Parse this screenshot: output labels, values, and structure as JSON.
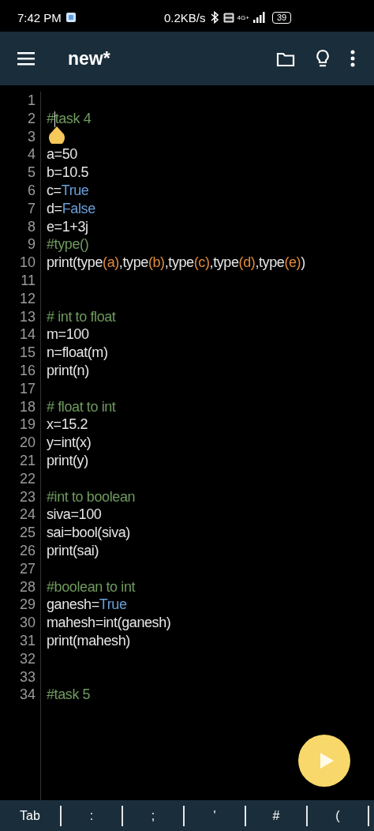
{
  "status_bar": {
    "time": "7:42 PM",
    "speed": "0.2KB/s",
    "network": "4G+",
    "battery": "39"
  },
  "app_bar": {
    "title": "new*"
  },
  "editor": {
    "lines": [
      {
        "number": "1"
      },
      {
        "number": "2",
        "cursor": true,
        "tokens": [
          {
            "kind": "comment",
            "text": "#task 4"
          }
        ]
      },
      {
        "number": "3"
      },
      {
        "number": "4",
        "tokens": [
          {
            "kind": "plain",
            "text": "a=50"
          }
        ]
      },
      {
        "number": "5",
        "tokens": [
          {
            "kind": "plain",
            "text": "b=10.5"
          }
        ]
      },
      {
        "number": "6",
        "tokens": [
          {
            "kind": "plain",
            "text": "c="
          },
          {
            "kind": "keyword",
            "text": "True"
          }
        ]
      },
      {
        "number": "7",
        "tokens": [
          {
            "kind": "plain",
            "text": "d="
          },
          {
            "kind": "keyword",
            "text": "False"
          }
        ]
      },
      {
        "number": "8",
        "tokens": [
          {
            "kind": "plain",
            "text": "e=1+3j"
          }
        ]
      },
      {
        "number": "9",
        "tokens": [
          {
            "kind": "comment",
            "text": "#type()"
          }
        ]
      },
      {
        "number": "10",
        "tokens": [
          {
            "kind": "plain",
            "text": "print(type"
          },
          {
            "kind": "bracket",
            "text": "(a)"
          },
          {
            "kind": "plain",
            "text": ",type"
          },
          {
            "kind": "bracket",
            "text": "(b)"
          },
          {
            "kind": "plain",
            "text": ",type"
          },
          {
            "kind": "bracket",
            "text": "(c)"
          },
          {
            "kind": "plain",
            "text": ",type"
          },
          {
            "kind": "bracket",
            "text": "(d)"
          },
          {
            "kind": "plain",
            "text": ",type"
          },
          {
            "kind": "bracket",
            "text": "(e)"
          },
          {
            "kind": "plain",
            "text": ")"
          }
        ]
      },
      {
        "number": "11"
      },
      {
        "number": "12"
      },
      {
        "number": "13",
        "tokens": [
          {
            "kind": "comment",
            "text": "# int to float"
          }
        ]
      },
      {
        "number": "14",
        "tokens": [
          {
            "kind": "plain",
            "text": "m=100"
          }
        ]
      },
      {
        "number": "15",
        "tokens": [
          {
            "kind": "plain",
            "text": "n=float(m)"
          }
        ]
      },
      {
        "number": "16",
        "tokens": [
          {
            "kind": "plain",
            "text": "print(n)"
          }
        ]
      },
      {
        "number": "17"
      },
      {
        "number": "18",
        "tokens": [
          {
            "kind": "comment",
            "text": "# float to int"
          }
        ]
      },
      {
        "number": "19",
        "tokens": [
          {
            "kind": "plain",
            "text": "x=15.2"
          }
        ]
      },
      {
        "number": "20",
        "tokens": [
          {
            "kind": "plain",
            "text": "y=int(x)"
          }
        ]
      },
      {
        "number": "21",
        "tokens": [
          {
            "kind": "plain",
            "text": "print(y)"
          }
        ]
      },
      {
        "number": "22"
      },
      {
        "number": "23",
        "tokens": [
          {
            "kind": "comment",
            "text": "#int to boolean"
          }
        ]
      },
      {
        "number": "24",
        "tokens": [
          {
            "kind": "plain",
            "text": "siva=100"
          }
        ]
      },
      {
        "number": "25",
        "tokens": [
          {
            "kind": "plain",
            "text": "sai=bool(siva)"
          }
        ]
      },
      {
        "number": "26",
        "tokens": [
          {
            "kind": "plain",
            "text": "print(sai)"
          }
        ]
      },
      {
        "number": "27"
      },
      {
        "number": "28",
        "tokens": [
          {
            "kind": "comment",
            "text": "#boolean to int"
          }
        ]
      },
      {
        "number": "29",
        "tokens": [
          {
            "kind": "plain",
            "text": "ganesh="
          },
          {
            "kind": "keyword",
            "text": "True"
          }
        ]
      },
      {
        "number": "30",
        "tokens": [
          {
            "kind": "plain",
            "text": "mahesh=int(ganesh)"
          }
        ]
      },
      {
        "number": "31",
        "tokens": [
          {
            "kind": "plain",
            "text": "print(mahesh)"
          }
        ]
      },
      {
        "number": "32"
      },
      {
        "number": "33"
      },
      {
        "number": "34",
        "tokens": [
          {
            "kind": "comment",
            "text": "#task 5"
          }
        ]
      }
    ]
  },
  "symbol_bar": [
    "Tab",
    ":",
    ";",
    "'",
    "#",
    "("
  ]
}
